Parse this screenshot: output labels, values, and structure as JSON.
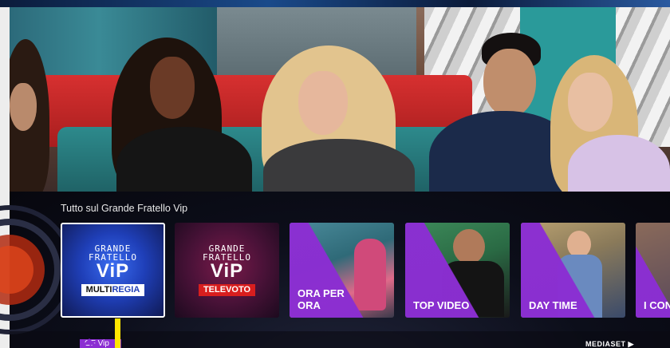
{
  "section": {
    "title": "Tutto sul Grande Fratello Vip"
  },
  "tiles": [
    {
      "line1": "GRANDE",
      "line2": "FRATELLO",
      "line3": "ViP",
      "badge_a": "MULTI",
      "badge_b": "REGIA",
      "badge_bg": "#ffffff"
    },
    {
      "line1": "GRANDE",
      "line2": "FRATELLO",
      "line3": "ViP",
      "badge": "TELEVOTO",
      "badge_bg": "#d81e1e"
    },
    {
      "label": "ORA PER ORA"
    },
    {
      "label": "TOP VIDEO"
    },
    {
      "label": "DAY TIME"
    },
    {
      "label": "I CON"
    }
  ],
  "nav": {
    "active": "GF Vip"
  },
  "brand": {
    "name": "MEDIASET ▶"
  },
  "colors": {
    "accent": "#8b2ed2",
    "cursor": "#ffe600",
    "televoto": "#d81e1e"
  }
}
